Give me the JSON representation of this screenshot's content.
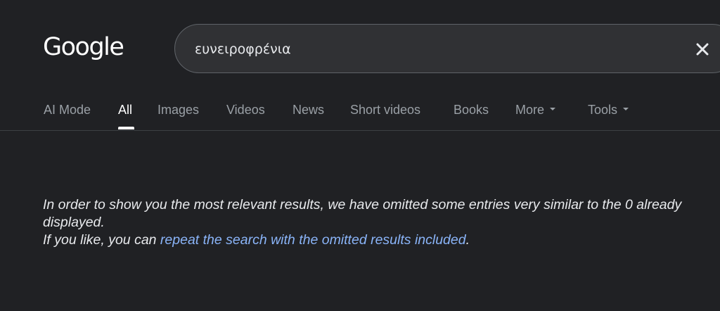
{
  "header": {
    "logo_text": "Google",
    "search": {
      "query": "ευνειροφρένια",
      "clear_icon": "close-icon"
    }
  },
  "tabs": [
    {
      "label": "AI Mode",
      "active": false
    },
    {
      "label": "All",
      "active": true
    },
    {
      "label": "Images",
      "active": false
    },
    {
      "label": "Videos",
      "active": false
    },
    {
      "label": "News",
      "active": false
    },
    {
      "label": "Short videos",
      "active": false
    },
    {
      "label": "Books",
      "active": false
    },
    {
      "label": "More",
      "active": false,
      "dropdown": true
    },
    {
      "label": "Tools",
      "active": false,
      "dropdown": true
    }
  ],
  "message": {
    "line1": "In order to show you the most relevant results, we have omitted some entries very similar to the 0 already displayed.",
    "line2_prefix": "If you like, you can ",
    "link_text": "repeat the search with the omitted results included",
    "line2_suffix": "."
  },
  "colors": {
    "background": "#202124",
    "link": "#8ab4f8",
    "tab_inactive": "#9aa0a6",
    "tab_active": "#ffffff"
  }
}
